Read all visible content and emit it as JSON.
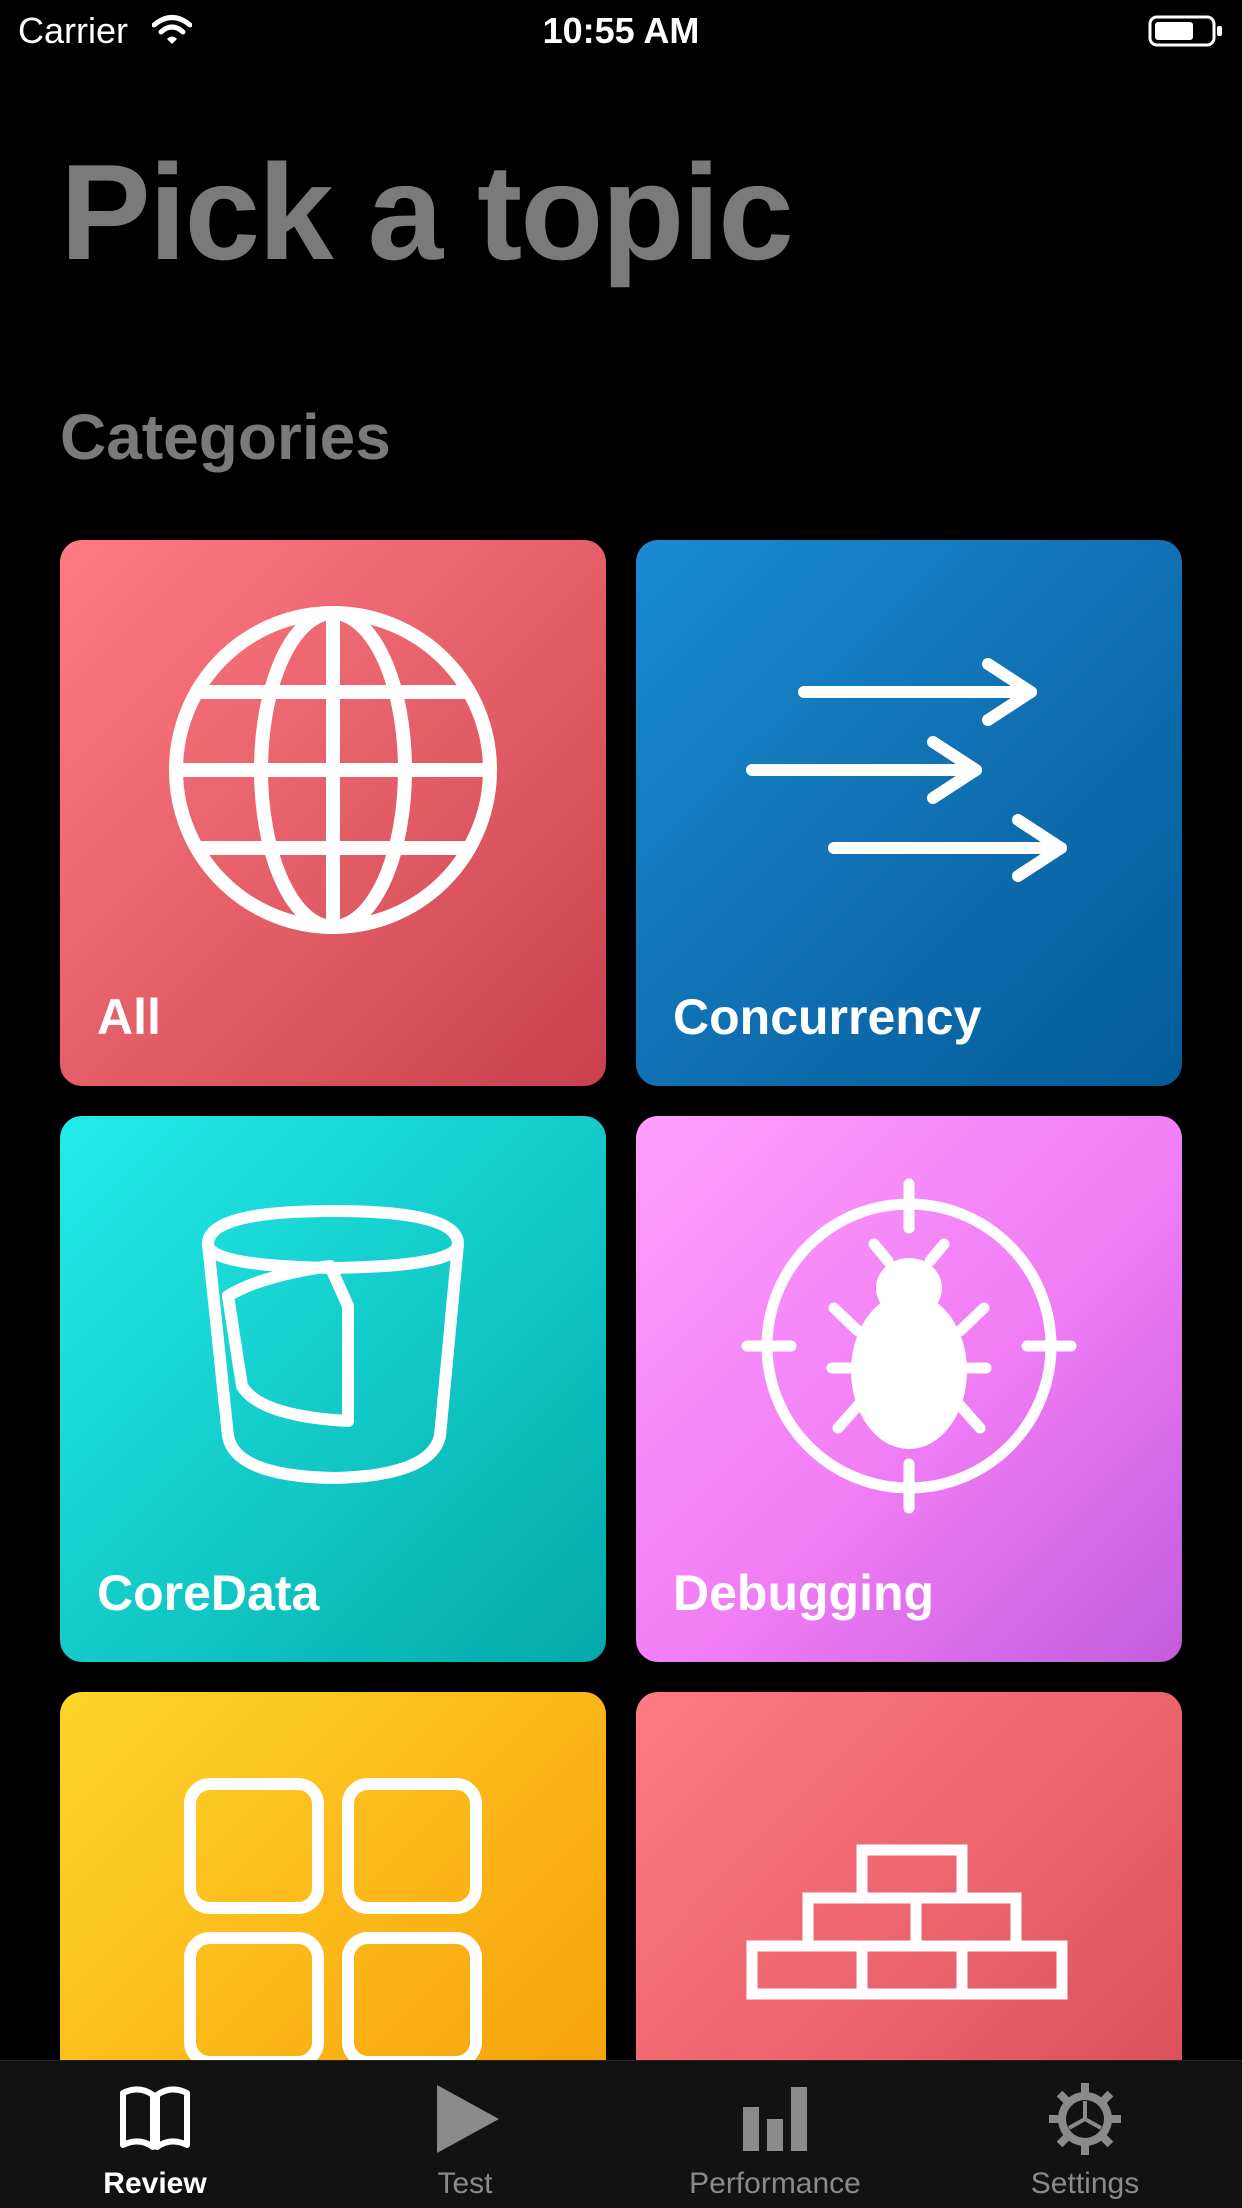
{
  "status_bar": {
    "carrier": "Carrier",
    "time": "10:55 AM",
    "wifi_icon": "wifi-icon",
    "battery_icon": "battery-icon"
  },
  "page": {
    "title": "Pick a topic",
    "section_title": "Categories"
  },
  "categories": [
    {
      "label": "All",
      "icon": "globe-icon",
      "colors": [
        "#ff7a82",
        "#c8414c"
      ]
    },
    {
      "label": "Concurrency",
      "icon": "arrows-icon",
      "colors": [
        "#1a8ad2",
        "#045a99"
      ]
    },
    {
      "label": "CoreData",
      "icon": "database-icon",
      "colors": [
        "#22eceb",
        "#02aaa9"
      ]
    },
    {
      "label": "Debugging",
      "icon": "bug-target-icon",
      "colors": [
        "#ff9efc",
        "#c25cdd"
      ]
    },
    {
      "label": "",
      "icon": "grid-icon",
      "colors": [
        "#fdd52a",
        "#ef9a06"
      ]
    },
    {
      "label": "",
      "icon": "bricks-icon",
      "colors": [
        "#ff7a82",
        "#d44954"
      ]
    }
  ],
  "tab_bar": {
    "tabs": [
      {
        "label": "Review",
        "icon": "book-icon",
        "active": true
      },
      {
        "label": "Test",
        "icon": "play-icon",
        "active": false
      },
      {
        "label": "Performance",
        "icon": "bar-chart-icon",
        "active": false
      },
      {
        "label": "Settings",
        "icon": "gear-icon",
        "active": false
      }
    ],
    "active_color": "#ffffff",
    "inactive_color": "#8a8a8a"
  }
}
